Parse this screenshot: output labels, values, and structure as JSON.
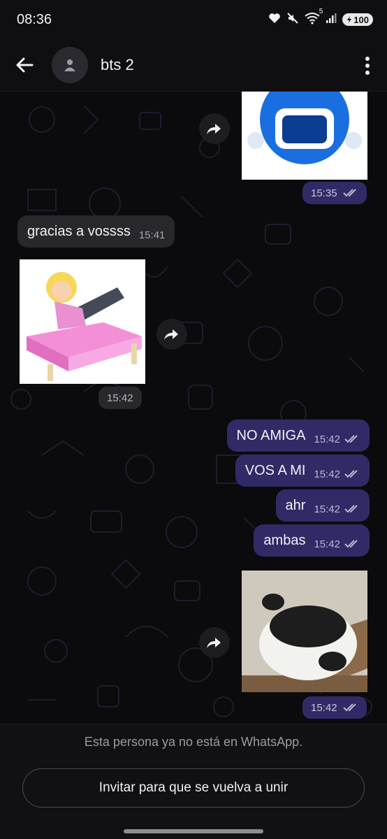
{
  "status_bar": {
    "time": "08:36",
    "signal_label": "5",
    "battery": "100"
  },
  "header": {
    "title": "bts 2"
  },
  "messages": [
    {
      "type": "image",
      "direction": "out",
      "subject": "blue-smiley-sticker",
      "time": "15:35"
    },
    {
      "type": "text",
      "direction": "in",
      "text": "gracias a vossss",
      "time": "15:41"
    },
    {
      "type": "image",
      "direction": "in",
      "subject": "girl-on-pink-bed-sticker",
      "time": "15:42"
    },
    {
      "type": "text",
      "direction": "out",
      "text": "NO AMIGA",
      "time": "15:42"
    },
    {
      "type": "text",
      "direction": "out",
      "text": "VOS A MI",
      "time": "15:42"
    },
    {
      "type": "text",
      "direction": "out",
      "text": "ahr",
      "time": "15:42"
    },
    {
      "type": "text",
      "direction": "out",
      "text": "ambas",
      "time": "15:42"
    },
    {
      "type": "image",
      "direction": "out",
      "subject": "panda-photo",
      "time": "15:42"
    }
  ],
  "footer": {
    "note": "Esta persona ya no está en WhatsApp.",
    "invite_label": "Invitar para que se vuelva a unir"
  },
  "colors": {
    "outgoing_bubble": "#302b66",
    "incoming_bubble": "#27272c",
    "background": "#0b0b0d"
  }
}
